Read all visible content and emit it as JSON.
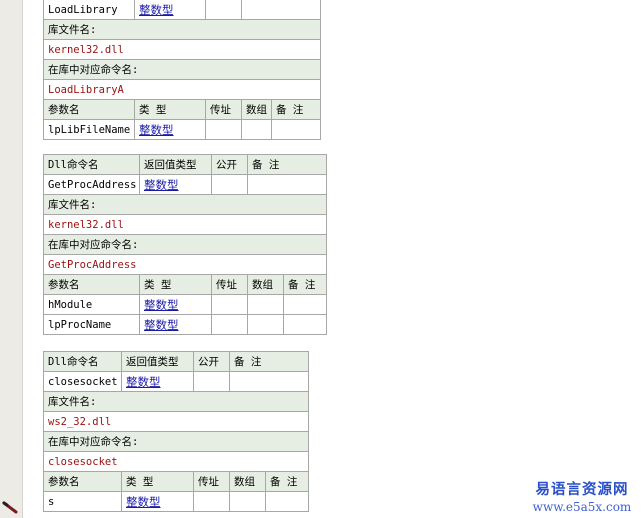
{
  "block1": {
    "top_row": {
      "name": "LoadLibrary",
      "type": "整数型"
    },
    "lib_label": "库文件名:",
    "lib_value": "kernel32.dll",
    "cmd_label": "在库中对应命令名:",
    "cmd_value": "LoadLibraryA",
    "param_headers": [
      "参数名",
      "类 型",
      "传址",
      "数组",
      "备 注"
    ],
    "params": [
      {
        "name": "lpLibFileName",
        "type": "整数型"
      }
    ]
  },
  "block2": {
    "headers": [
      "Dll命令名",
      "返回值类型",
      "公开",
      "备 注"
    ],
    "name": "GetProcAddress",
    "type": "整数型",
    "lib_label": "库文件名:",
    "lib_value": "kernel32.dll",
    "cmd_label": "在库中对应命令名:",
    "cmd_value": "GetProcAddress",
    "param_headers": [
      "参数名",
      "类 型",
      "传址",
      "数组",
      "备 注"
    ],
    "params": [
      {
        "name": "hModule",
        "type": "整数型"
      },
      {
        "name": "lpProcName",
        "type": "整数型"
      }
    ]
  },
  "block3": {
    "headers": [
      "Dll命令名",
      "返回值类型",
      "公开",
      "备 注"
    ],
    "name": "closesocket",
    "type": "整数型",
    "lib_label": "库文件名:",
    "lib_value": "ws2_32.dll",
    "cmd_label": "在库中对应命令名:",
    "cmd_value": "closesocket",
    "param_headers": [
      "参数名",
      "类 型",
      "传址",
      "数组",
      "备 注"
    ],
    "params": [
      {
        "name": "s",
        "type": "整数型"
      }
    ]
  },
  "watermark": {
    "cn": "易语言资源网",
    "url": "www.e5a5x.com"
  },
  "icons": {
    "edit": "pen-icon"
  }
}
